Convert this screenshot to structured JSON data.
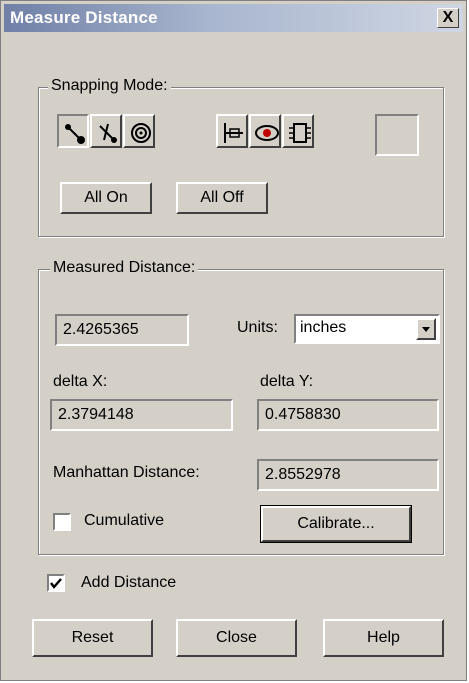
{
  "window": {
    "title": "Measure Distance",
    "close_glyph": "X"
  },
  "snapping": {
    "label": "Snapping Mode:",
    "buttons": [
      {
        "name": "snap-endpoint-icon"
      },
      {
        "name": "snap-midpoint-icon"
      },
      {
        "name": "snap-center-icon"
      },
      {
        "name": "snap-pin-icon"
      },
      {
        "name": "snap-via-icon"
      },
      {
        "name": "snap-component-icon"
      }
    ],
    "all_on": "All On",
    "all_off": "All Off"
  },
  "measured": {
    "label": "Measured Distance:",
    "value": "2.4265365",
    "units_label": "Units:",
    "units_value": "inches",
    "delta_x_label": "delta X:",
    "delta_x_value": "2.3794148",
    "delta_y_label": "delta Y:",
    "delta_y_value": "0.4758830",
    "manhattan_label": "Manhattan Distance:",
    "manhattan_value": "2.8552978",
    "cumulative_label": "Cumulative",
    "cumulative_checked": false,
    "calibrate": "Calibrate..."
  },
  "add_distance": {
    "label": "Add Distance",
    "checked": true
  },
  "footer": {
    "reset": "Reset",
    "close": "Close",
    "help": "Help"
  }
}
